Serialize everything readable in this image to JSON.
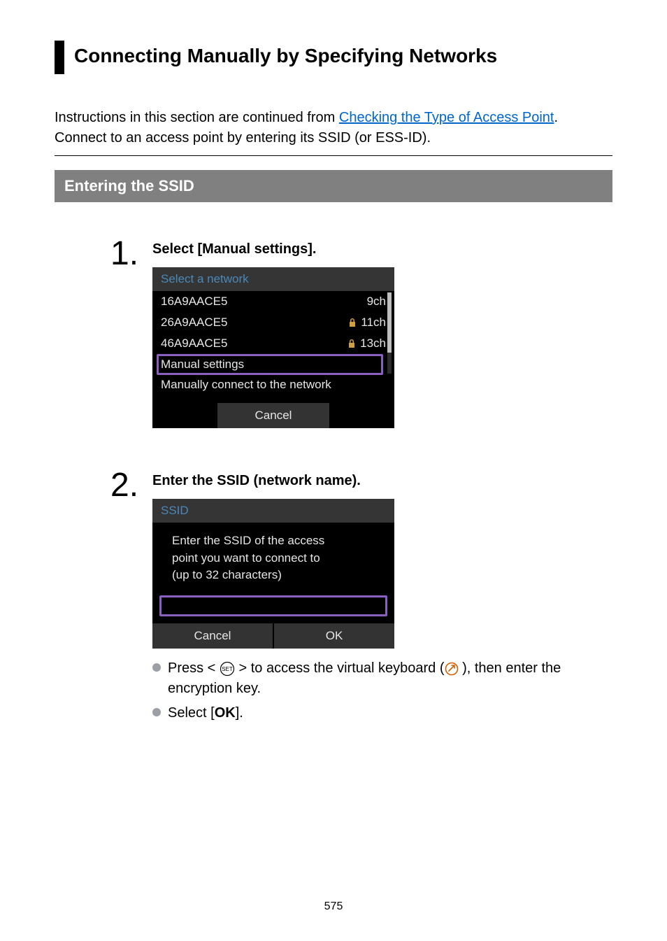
{
  "title": "Connecting Manually by Specifying Networks",
  "intro_prefix": "Instructions in this section are continued from ",
  "intro_link": "Checking the Type of Access Point",
  "intro_suffix": ".",
  "intro_line2": "Connect to an access point by entering its SSID (or ESS-ID).",
  "subheading": "Entering the SSID",
  "step1": {
    "num": "1.",
    "title": "Select [Manual settings].",
    "screen": {
      "header": "Select a network",
      "rows": [
        {
          "ssid": "16A9AACE5",
          "lock": false,
          "ch": "9ch"
        },
        {
          "ssid": "26A9AACE5",
          "lock": true,
          "ch": "11ch"
        },
        {
          "ssid": "46A9AACE5",
          "lock": true,
          "ch": "13ch"
        }
      ],
      "highlight": "Manual settings",
      "desc": "Manually connect to the network",
      "cancel": "Cancel"
    }
  },
  "step2": {
    "num": "2.",
    "title": "Enter the SSID (network name).",
    "screen": {
      "header": "SSID",
      "body_l1": "Enter the SSID of the access",
      "body_l2": "point you want to connect to",
      "body_l3": "(up to 32 characters)",
      "cancel": "Cancel",
      "ok": "OK"
    },
    "bullet1_a": "Press < ",
    "bullet1_b": " > to access the virtual keyboard (",
    "bullet1_c": " ), then enter the encryption key.",
    "bullet2_a": "Select [",
    "bullet2_b": "OK",
    "bullet2_c": "]."
  },
  "page_number": "575"
}
